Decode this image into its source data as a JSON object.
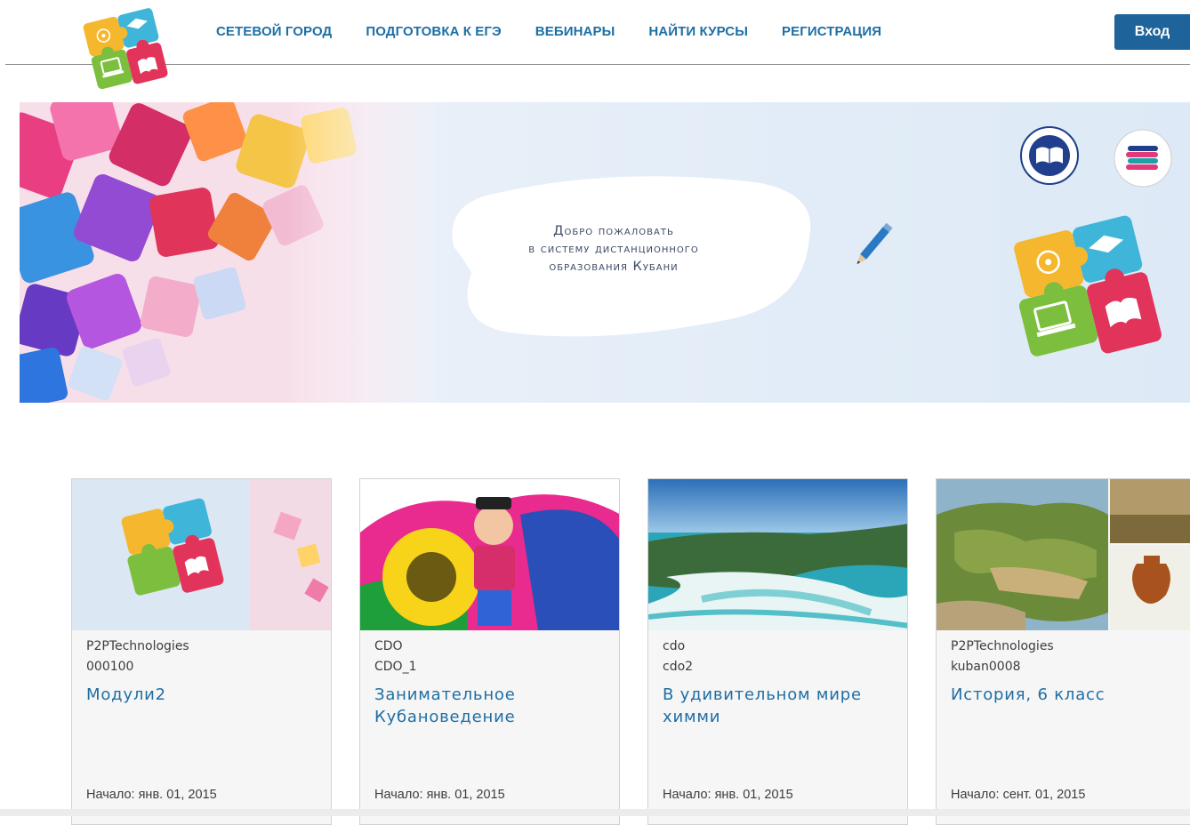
{
  "nav": {
    "items": [
      {
        "label": "СЕТЕВОЙ ГОРОД"
      },
      {
        "label": "ПОДГОТОВКА К ЕГЭ"
      },
      {
        "label": "ВЕБИНАРЫ"
      },
      {
        "label": "НАЙТИ КУРСЫ"
      },
      {
        "label": "РЕГИСТРАЦИЯ"
      }
    ],
    "login_label": "Вход"
  },
  "banner": {
    "welcome_lines": [
      "Добро пожаловать",
      "в систему дистанционного",
      "образования Кубани"
    ]
  },
  "colors": {
    "nav_link": "#1d6fa5",
    "login_button": "#1f639b",
    "card_title": "#1f6ea4"
  },
  "icons": [
    "puzzle-logo-icon",
    "pencil-icon",
    "ministry-emblem-icon",
    "institute-emblem-icon"
  ],
  "courses": [
    {
      "org": "P2PTechnologies",
      "code": "000100",
      "title": "Модули2",
      "start": "Начало: янв. 01, 2015"
    },
    {
      "org": "CDO",
      "code": "CDO_1",
      "title": "Занимательное Кубановедение",
      "start": "Начало: янв. 01, 2015"
    },
    {
      "org": "cdo",
      "code": "cdo2",
      "title": "В удивительном мире химми",
      "start": "Начало: янв. 01, 2015"
    },
    {
      "org": "P2PTechnologies",
      "code": "kuban0008",
      "title": "История, 6 класс",
      "start": "Начало: сент. 01, 2015"
    }
  ]
}
